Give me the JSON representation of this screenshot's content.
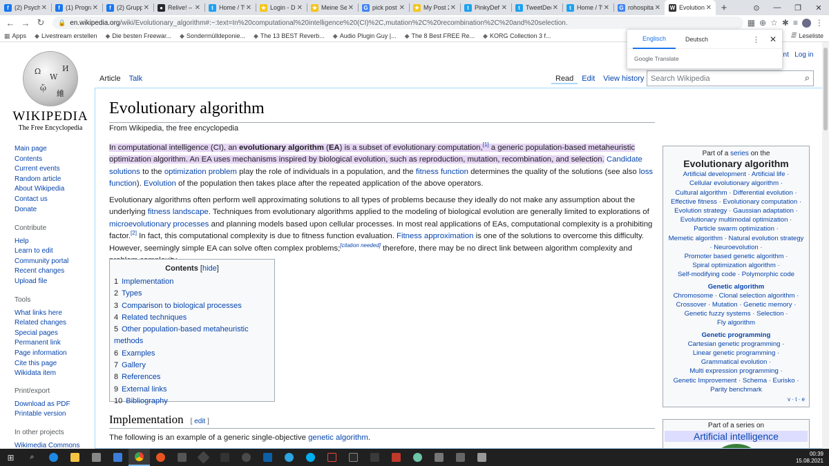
{
  "browser": {
    "tabs": [
      {
        "title": "(2) Psycho",
        "color": "#1877f2",
        "glyph": "f"
      },
      {
        "title": "(1) Progra",
        "color": "#1877f2",
        "glyph": "f"
      },
      {
        "title": "(2) Grupp",
        "color": "#1877f2",
        "glyph": "f"
      },
      {
        "title": "Relive! – n",
        "color": "#24292e",
        "glyph": "●"
      },
      {
        "title": "Home / Tw",
        "color": "#1da1f2",
        "glyph": "t"
      },
      {
        "title": "Login - Dis",
        "color": "#f5c518",
        "glyph": "★"
      },
      {
        "title": "Meine Ser",
        "color": "#f5c518",
        "glyph": "★"
      },
      {
        "title": "pick post",
        "color": "#4285f4",
        "glyph": "G"
      },
      {
        "title": "My Post 2",
        "color": "#f5c518",
        "glyph": "★"
      },
      {
        "title": "PinkyDef",
        "color": "#1da1f2",
        "glyph": "t"
      },
      {
        "title": "TweetDec",
        "color": "#1da1f2",
        "glyph": "t"
      },
      {
        "title": "Home / Tw",
        "color": "#1da1f2",
        "glyph": "t"
      },
      {
        "title": "rohospital",
        "color": "#4285f4",
        "glyph": "G"
      },
      {
        "title": "Evolutiona",
        "color": "#333333",
        "glyph": "W",
        "active": true
      }
    ],
    "url_host": "en.wikipedia.org",
    "url_path": "/wiki/Evolutionary_algorithm#:~:text=In%20computational%20intelligence%20(CI)%2C,mutation%2C%20recombination%2C%20and%20selection.",
    "bookmarks": [
      "Apps",
      "Livestream erstellen",
      "Die besten Freewar...",
      "Sondermülldeponie...",
      "The 13 BEST Reverb...",
      "Audio Plugin Guy |...",
      "The 8 Best FREE Re...",
      "KORG Collection 3 f..."
    ],
    "reading_list": "Leseliste"
  },
  "translate": {
    "lang_from": "Englisch",
    "lang_to": "Deutsch",
    "brand": "Google Translate"
  },
  "wiki": {
    "logo_title": "WIKIPEDIA",
    "logo_sub": "The Free Encyclopedia",
    "nav": [
      "Main page",
      "Contents",
      "Current events",
      "Random article",
      "About Wikipedia",
      "Contact us",
      "Donate"
    ],
    "contribute_head": "Contribute",
    "contribute": [
      "Help",
      "Learn to edit",
      "Community portal",
      "Recent changes",
      "Upload file"
    ],
    "tools_head": "Tools",
    "tools": [
      "What links here",
      "Related changes",
      "Special pages",
      "Permanent link",
      "Page information",
      "Cite this page",
      "Wikidata item"
    ],
    "print_head": "Print/export",
    "print": [
      "Download as PDF",
      "Printable version"
    ],
    "other_head": "In other projects",
    "other": [
      "Wikimedia Commons"
    ],
    "tab_article": "Article",
    "tab_talk": "Talk",
    "tab_read": "Read",
    "tab_edit": "Edit",
    "tab_history": "View history",
    "search_placeholder": "Search Wikipedia",
    "account": "unt",
    "login": "Log in",
    "title": "Evolutionary algorithm",
    "from": "From Wikipedia, the free encyclopedia",
    "p1": {
      "hl_a": "In computational intelligence (CI), an ",
      "bold1": "evolutionary algorithm",
      "hl_b": " (",
      "bold2": "EA",
      "hl_c": ") is a subset of evolutionary computation,",
      "ref1": "[1]",
      "hl_d": " a generic population-based metaheuristic optimization algorithm. An EA uses mechanisms inspired by biological evolution, such as reproduction, mutation, recombination, and selection.",
      "l1": "Candidate solutions",
      "t1": " to the ",
      "l2": "optimization problem",
      "t2": " play the role of individuals in a population, and the ",
      "l3": "fitness function",
      "t3": " determines the quality of the solutions (see also ",
      "l4": "loss function",
      "t4": "). ",
      "l5": "Evolution",
      "t5": " of the population then takes place after the repeated application of the above operators."
    },
    "p2": {
      "a": "Evolutionary algorithms often perform well approximating solutions to all types of problems because they ideally do not make any assumption about the underlying ",
      "l1": "fitness landscape",
      "b": ". Techniques from evolutionary algorithms applied to the modeling of biological evolution are generally limited to explorations of ",
      "l2": "microevolutionary processes",
      "c": " and planning models based upon cellular processes. In most real applications of EAs, computational complexity is a prohibiting factor.",
      "ref2": "[2]",
      "d": " In fact, this computational complexity is due to fitness function evaluation. ",
      "l3": "Fitness approximation",
      "e": " is one of the solutions to overcome this difficulty. However, seemingly simple EA can solve often complex problems;",
      "cn": "[citation needed]",
      "f": " therefore, there may be no direct link between algorithm complexity and problem complexity."
    },
    "toc_title": "Contents",
    "toc_hide": "hide",
    "toc": [
      {
        "n": "1",
        "t": "Implementation"
      },
      {
        "n": "2",
        "t": "Types"
      },
      {
        "n": "3",
        "t": "Comparison to biological processes"
      },
      {
        "n": "4",
        "t": "Related techniques"
      },
      {
        "n": "5",
        "t": "Other population-based metaheuristic methods"
      },
      {
        "n": "6",
        "t": "Examples"
      },
      {
        "n": "7",
        "t": "Gallery"
      },
      {
        "n": "8",
        "t": "References"
      },
      {
        "n": "9",
        "t": "External links"
      },
      {
        "n": "10",
        "t": "Bibliography"
      }
    ],
    "h2": "Implementation",
    "h2_edit": "edit",
    "last_a": "The following is an example of a generic single-objective ",
    "last_l": "genetic algorithm",
    "last_b": ".",
    "navbox": {
      "pre": "Part of a ",
      "series": "series",
      "post": " on the",
      "title": "Evolutionary algorithm",
      "lines1": [
        "Artificial development · Artificial life ·",
        "Cellular evolutionary algorithm ·",
        "Cultural algorithm · Differential evolution ·",
        "Effective fitness · Evolutionary computation ·",
        "Evolution strategy · Gaussian adaptation ·",
        "Evolutionary multimodal optimization ·",
        "Particle swarm optimization ·",
        "Memetic algorithm · Natural evolution strategy",
        "· Neuroevolution ·",
        "Promoter based genetic algorithm ·",
        "Spiral optimization algorithm ·",
        "Self-modifying code · Polymorphic code"
      ],
      "g1": "Genetic algorithm",
      "lines2": [
        "Chromosome · Clonal selection algorithm ·",
        "Crossover · Mutation · Genetic memory ·",
        "Genetic fuzzy systems · Selection ·",
        "Fly algorithm"
      ],
      "g2": "Genetic programming",
      "lines3": [
        "Cartesian genetic programming ·",
        "Linear genetic programming ·",
        "Grammatical evolution ·",
        "Multi expression programming ·",
        "Genetic Improvement · Schema · Eurisko ·",
        "Parity benchmark"
      ],
      "vte": "v · t · e"
    },
    "navbox2": {
      "pre": "Part of a series on",
      "title": "Artificial intelligence"
    }
  },
  "taskbar": {
    "time": "00:39",
    "date": "15.08.2021"
  }
}
